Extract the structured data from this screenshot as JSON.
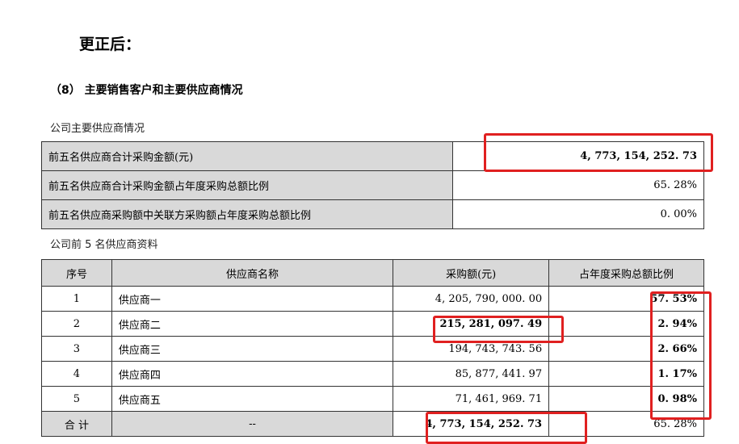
{
  "heading": "更正后：",
  "section_title": "（8）  主要销售客户和主要供应商情况",
  "summary_caption": "公司主要供应商情况",
  "summary_rows": [
    {
      "label": "前五名供应商合计采购金额(元)",
      "value": "4, 773, 154, 252. 73"
    },
    {
      "label": "前五名供应商合计采购金额占年度采购总额比例",
      "value": "65. 28%"
    },
    {
      "label": "前五名供应商采购额中关联方采购额占年度采购总额比例",
      "value": "0. 00%"
    }
  ],
  "supplier_caption": "公司前 5 名供应商资料",
  "supplier_headers": [
    "序号",
    "供应商名称",
    "采购额(元)",
    "占年度采购总额比例"
  ],
  "suppliers": [
    {
      "index": "1",
      "name": "供应商一",
      "amount": "4, 205, 790, 000. 00",
      "percent": "57. 53%"
    },
    {
      "index": "2",
      "name": "供应商二",
      "amount": "215, 281, 097. 49",
      "percent": "2. 94%"
    },
    {
      "index": "3",
      "name": "供应商三",
      "amount": "194, 743, 743. 56",
      "percent": "2. 66%"
    },
    {
      "index": "4",
      "name": "供应商四",
      "amount": "85, 877, 441. 97",
      "percent": "1. 17%"
    },
    {
      "index": "5",
      "name": "供应商五",
      "amount": "71, 461, 969. 71",
      "percent": "0. 98%"
    }
  ],
  "total_row": {
    "label": "合  计",
    "name": "--",
    "amount": "4, 773, 154, 252. 73",
    "percent": "65. 28%"
  },
  "colors": {
    "highlight": "#e02020",
    "header_bg": "#d9d9d9"
  }
}
